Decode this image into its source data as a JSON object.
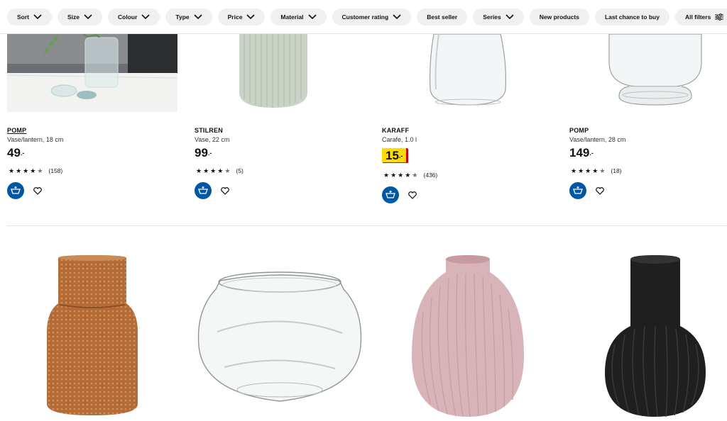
{
  "filters": [
    {
      "label": "Sort",
      "dropdown": true
    },
    {
      "label": "Size",
      "dropdown": true
    },
    {
      "label": "Colour",
      "dropdown": true
    },
    {
      "label": "Type",
      "dropdown": true
    },
    {
      "label": "Price",
      "dropdown": true
    },
    {
      "label": "Material",
      "dropdown": true
    },
    {
      "label": "Customer rating",
      "dropdown": true
    },
    {
      "label": "Best seller",
      "dropdown": false
    },
    {
      "label": "Series",
      "dropdown": true
    },
    {
      "label": "New products",
      "dropdown": false
    },
    {
      "label": "Last chance to buy",
      "dropdown": false
    },
    {
      "label": "All filters",
      "dropdown": false,
      "icon": "sliders-icon"
    }
  ],
  "products_row1": [
    {
      "name": "POMP",
      "desc": "Vase/lantern, 18 cm",
      "price": "49",
      "price_suffix": ".-",
      "rating": 4.5,
      "reviews": "(158)",
      "highlighted": false,
      "underlined": true
    },
    {
      "name": "STILREN",
      "desc": "Vase, 22 cm",
      "price": "99",
      "price_suffix": ".-",
      "rating": 4.5,
      "reviews": "(5)",
      "highlighted": false,
      "underlined": false
    },
    {
      "name": "KARAFF",
      "desc": "Carafe, 1.0 l",
      "price": "15",
      "price_suffix": ".-",
      "rating": 4.5,
      "reviews": "(436)",
      "highlighted": true,
      "underlined": false
    },
    {
      "name": "POMP",
      "desc": "Vase/lantern, 28 cm",
      "price": "149",
      "price_suffix": ".-",
      "rating": 4.5,
      "reviews": "(18)",
      "highlighted": false,
      "underlined": false
    }
  ],
  "products_row2": [
    {
      "image": "amber-glass-vase"
    },
    {
      "image": "clear-glass-bowl-vase"
    },
    {
      "image": "pink-ribbed-vase"
    },
    {
      "image": "black-ribbed-vase"
    }
  ],
  "colors": {
    "accent": "#0058a3",
    "price_tag": "#ffdb00",
    "price_tag_edge": "#cc0008",
    "pill_bg": "#f0f0f0"
  },
  "icons": {
    "cart": "add-to-cart-icon",
    "favourite": "heart-icon",
    "star": "star-icon",
    "chevron": "chevron-down-icon"
  }
}
